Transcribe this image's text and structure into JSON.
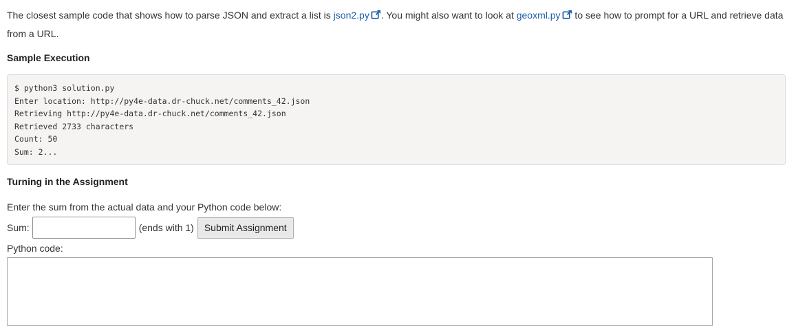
{
  "intro": {
    "text1": "The closest sample code that shows how to parse JSON and extract a list is ",
    "link1": "json2.py",
    "text2": ". You might also want to look at ",
    "link2": "geoxml.py",
    "text3": " to see how to prompt for a URL and retrieve data from a URL.",
    "icon": "external-link-icon",
    "link_color": "#1a5ea8"
  },
  "sample_execution": {
    "heading": "Sample Execution",
    "lines": [
      "$ python3 solution.py",
      "Enter location: http://py4e-data.dr-chuck.net/comments_42.json",
      "Retrieving http://py4e-data.dr-chuck.net/comments_42.json",
      "Retrieved 2733 characters",
      "Count: 50",
      "Sum: 2..."
    ]
  },
  "turnin": {
    "heading": "Turning in the Assignment",
    "instructions": "Enter the sum from the actual data and your Python code below:",
    "sum_label": "Sum:",
    "sum_value": "",
    "hint": "(ends with 1)",
    "submit_label": "Submit Assignment",
    "code_label": "Python code:",
    "code_value": ""
  }
}
